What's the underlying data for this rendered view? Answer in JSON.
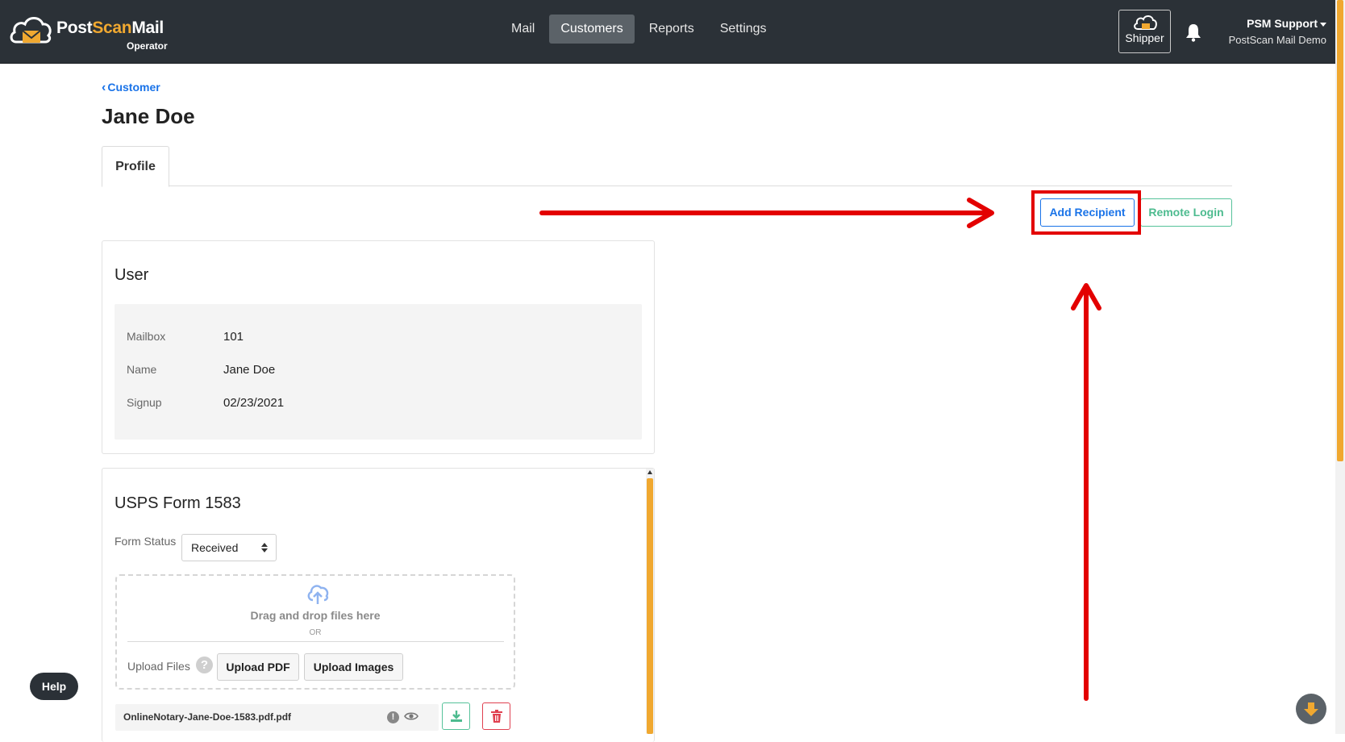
{
  "app": {
    "logo_post": "Post",
    "logo_scan": "Scan",
    "logo_mail": "Mail",
    "logo_sub": "Operator"
  },
  "nav": {
    "items": [
      {
        "label": "Mail"
      },
      {
        "label": "Customers",
        "active": true
      },
      {
        "label": "Reports"
      },
      {
        "label": "Settings"
      }
    ]
  },
  "header": {
    "shipper_label": "Shipper",
    "user_name": "PSM Support",
    "user_org": "PostScan Mail Demo"
  },
  "breadcrumb": {
    "back_label": "Customer"
  },
  "page": {
    "title": "Jane Doe",
    "tabs": [
      {
        "label": "Profile",
        "active": true
      }
    ]
  },
  "actions": {
    "add_recipient": "Add Recipient",
    "remote_login": "Remote Login"
  },
  "user_card": {
    "title": "User",
    "rows": [
      {
        "key": "Mailbox",
        "value": "101"
      },
      {
        "key": "Name",
        "value": "Jane Doe"
      },
      {
        "key": "Signup",
        "value": "02/23/2021"
      }
    ]
  },
  "form_card": {
    "title": "USPS Form 1583",
    "status_label": "Form Status",
    "status_value": "Received",
    "dropzone_text": "Drag and drop files here",
    "dropzone_or": "OR",
    "upload_label": "Upload Files",
    "upload_pdf": "Upload PDF",
    "upload_images": "Upload Images",
    "file_name": "OnlineNotary-Jane-Doe-1583.pdf.pdf"
  },
  "help": {
    "label": "Help"
  },
  "colors": {
    "topbar": "#2b3137",
    "accent_orange": "#f0a830",
    "primary_blue": "#1a73e8",
    "success_green": "#4dbb8f",
    "danger_red": "#e04050",
    "annotation_red": "#e30000"
  }
}
